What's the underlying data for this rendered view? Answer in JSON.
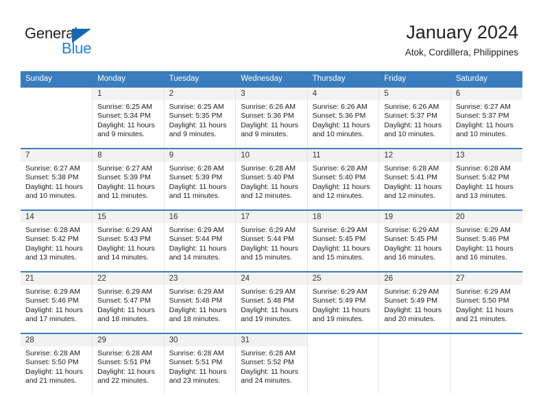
{
  "brand": {
    "name_part1": "General",
    "name_part2": "Blue",
    "triangle_icon": "triangle-icon",
    "accent_dark": "#231f20",
    "accent_blue": "#1e7fd4"
  },
  "header": {
    "title": "January 2024",
    "location": "Atok, Cordillera, Philippines"
  },
  "theme": {
    "header_blue": "#3a7cbe",
    "daynum_bg": "#f2f2f2",
    "cell_border": "#e3e3e3"
  },
  "columns": [
    "Sunday",
    "Monday",
    "Tuesday",
    "Wednesday",
    "Thursday",
    "Friday",
    "Saturday"
  ],
  "weeks": [
    [
      {
        "day": "",
        "lines": []
      },
      {
        "day": "1",
        "lines": [
          "Sunrise: 6:25 AM",
          "Sunset: 5:34 PM",
          "Daylight: 11 hours",
          "and 9 minutes."
        ]
      },
      {
        "day": "2",
        "lines": [
          "Sunrise: 6:25 AM",
          "Sunset: 5:35 PM",
          "Daylight: 11 hours",
          "and 9 minutes."
        ]
      },
      {
        "day": "3",
        "lines": [
          "Sunrise: 6:26 AM",
          "Sunset: 5:36 PM",
          "Daylight: 11 hours",
          "and 9 minutes."
        ]
      },
      {
        "day": "4",
        "lines": [
          "Sunrise: 6:26 AM",
          "Sunset: 5:36 PM",
          "Daylight: 11 hours",
          "and 10 minutes."
        ]
      },
      {
        "day": "5",
        "lines": [
          "Sunrise: 6:26 AM",
          "Sunset: 5:37 PM",
          "Daylight: 11 hours",
          "and 10 minutes."
        ]
      },
      {
        "day": "6",
        "lines": [
          "Sunrise: 6:27 AM",
          "Sunset: 5:37 PM",
          "Daylight: 11 hours",
          "and 10 minutes."
        ]
      }
    ],
    [
      {
        "day": "7",
        "lines": [
          "Sunrise: 6:27 AM",
          "Sunset: 5:38 PM",
          "Daylight: 11 hours",
          "and 10 minutes."
        ]
      },
      {
        "day": "8",
        "lines": [
          "Sunrise: 6:27 AM",
          "Sunset: 5:39 PM",
          "Daylight: 11 hours",
          "and 11 minutes."
        ]
      },
      {
        "day": "9",
        "lines": [
          "Sunrise: 6:28 AM",
          "Sunset: 5:39 PM",
          "Daylight: 11 hours",
          "and 11 minutes."
        ]
      },
      {
        "day": "10",
        "lines": [
          "Sunrise: 6:28 AM",
          "Sunset: 5:40 PM",
          "Daylight: 11 hours",
          "and 12 minutes."
        ]
      },
      {
        "day": "11",
        "lines": [
          "Sunrise: 6:28 AM",
          "Sunset: 5:40 PM",
          "Daylight: 11 hours",
          "and 12 minutes."
        ]
      },
      {
        "day": "12",
        "lines": [
          "Sunrise: 6:28 AM",
          "Sunset: 5:41 PM",
          "Daylight: 11 hours",
          "and 12 minutes."
        ]
      },
      {
        "day": "13",
        "lines": [
          "Sunrise: 6:28 AM",
          "Sunset: 5:42 PM",
          "Daylight: 11 hours",
          "and 13 minutes."
        ]
      }
    ],
    [
      {
        "day": "14",
        "lines": [
          "Sunrise: 6:28 AM",
          "Sunset: 5:42 PM",
          "Daylight: 11 hours",
          "and 13 minutes."
        ]
      },
      {
        "day": "15",
        "lines": [
          "Sunrise: 6:29 AM",
          "Sunset: 5:43 PM",
          "Daylight: 11 hours",
          "and 14 minutes."
        ]
      },
      {
        "day": "16",
        "lines": [
          "Sunrise: 6:29 AM",
          "Sunset: 5:44 PM",
          "Daylight: 11 hours",
          "and 14 minutes."
        ]
      },
      {
        "day": "17",
        "lines": [
          "Sunrise: 6:29 AM",
          "Sunset: 5:44 PM",
          "Daylight: 11 hours",
          "and 15 minutes."
        ]
      },
      {
        "day": "18",
        "lines": [
          "Sunrise: 6:29 AM",
          "Sunset: 5:45 PM",
          "Daylight: 11 hours",
          "and 15 minutes."
        ]
      },
      {
        "day": "19",
        "lines": [
          "Sunrise: 6:29 AM",
          "Sunset: 5:45 PM",
          "Daylight: 11 hours",
          "and 16 minutes."
        ]
      },
      {
        "day": "20",
        "lines": [
          "Sunrise: 6:29 AM",
          "Sunset: 5:46 PM",
          "Daylight: 11 hours",
          "and 16 minutes."
        ]
      }
    ],
    [
      {
        "day": "21",
        "lines": [
          "Sunrise: 6:29 AM",
          "Sunset: 5:46 PM",
          "Daylight: 11 hours",
          "and 17 minutes."
        ]
      },
      {
        "day": "22",
        "lines": [
          "Sunrise: 6:29 AM",
          "Sunset: 5:47 PM",
          "Daylight: 11 hours",
          "and 18 minutes."
        ]
      },
      {
        "day": "23",
        "lines": [
          "Sunrise: 6:29 AM",
          "Sunset: 5:48 PM",
          "Daylight: 11 hours",
          "and 18 minutes."
        ]
      },
      {
        "day": "24",
        "lines": [
          "Sunrise: 6:29 AM",
          "Sunset: 5:48 PM",
          "Daylight: 11 hours",
          "and 19 minutes."
        ]
      },
      {
        "day": "25",
        "lines": [
          "Sunrise: 6:29 AM",
          "Sunset: 5:49 PM",
          "Daylight: 11 hours",
          "and 19 minutes."
        ]
      },
      {
        "day": "26",
        "lines": [
          "Sunrise: 6:29 AM",
          "Sunset: 5:49 PM",
          "Daylight: 11 hours",
          "and 20 minutes."
        ]
      },
      {
        "day": "27",
        "lines": [
          "Sunrise: 6:29 AM",
          "Sunset: 5:50 PM",
          "Daylight: 11 hours",
          "and 21 minutes."
        ]
      }
    ],
    [
      {
        "day": "28",
        "lines": [
          "Sunrise: 6:28 AM",
          "Sunset: 5:50 PM",
          "Daylight: 11 hours",
          "and 21 minutes."
        ]
      },
      {
        "day": "29",
        "lines": [
          "Sunrise: 6:28 AM",
          "Sunset: 5:51 PM",
          "Daylight: 11 hours",
          "and 22 minutes."
        ]
      },
      {
        "day": "30",
        "lines": [
          "Sunrise: 6:28 AM",
          "Sunset: 5:51 PM",
          "Daylight: 11 hours",
          "and 23 minutes."
        ]
      },
      {
        "day": "31",
        "lines": [
          "Sunrise: 6:28 AM",
          "Sunset: 5:52 PM",
          "Daylight: 11 hours",
          "and 24 minutes."
        ]
      },
      {
        "day": "",
        "lines": []
      },
      {
        "day": "",
        "lines": []
      },
      {
        "day": "",
        "lines": []
      }
    ]
  ]
}
